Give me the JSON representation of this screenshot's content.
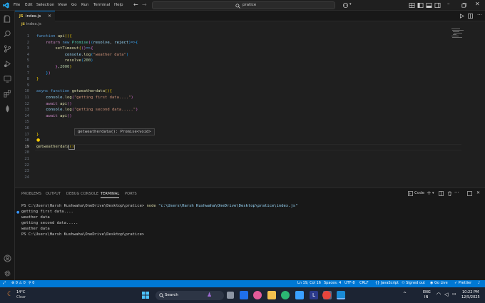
{
  "menu": [
    "File",
    "Edit",
    "Selection",
    "View",
    "Go",
    "Run",
    "Terminal",
    "Help"
  ],
  "command_center": "pratice",
  "tab": {
    "icon": "JS",
    "name": "index.js",
    "close": "×"
  },
  "breadcrumb": "index.js",
  "hover_text": "getweatherdata(): Promise<void>",
  "panel_tabs": [
    "PROBLEMS",
    "OUTPUT",
    "DEBUG CONSOLE",
    "TERMINAL",
    "PORTS"
  ],
  "terminal_type": "Code",
  "terminal": {
    "prompt1": "PS C:\\Users\\Harsh Kushwaha\\OneDrive\\Desktop\\pratice> ",
    "cmd": "node",
    "arg": " \"c:\\Users\\Harsh Kushwaha\\OneDrive\\Desktop\\pratice\\index.js\"",
    "out": [
      "getting first data....",
      "weather data",
      "getting second data.....",
      "weather data"
    ],
    "prompt2": "PS C:\\Users\\Harsh Kushwaha\\OneDrive\\Desktop\\pratice>"
  },
  "status": {
    "errors": "⊗ 0 ⚠ 0",
    "warnings": "0",
    "position": "Ln 19, Col 16",
    "spaces": "Spaces: 4",
    "encoding": "UTF-8",
    "eol": "CRLF",
    "language": "JavaScript",
    "account": "Signed out",
    "golive": "Go Live",
    "prettier": "Prettier"
  },
  "taskbar": {
    "weather_temp": "14°C",
    "weather_desc": "Clear",
    "search": "Search",
    "lang1": "ENG",
    "lang2": "IN",
    "time": "10:22 PM",
    "date": "12/5/2025"
  },
  "line_numbers": [
    "1",
    "2",
    "3",
    "4",
    "5",
    "6",
    "7",
    "8",
    "9",
    "10",
    "11",
    "12",
    "13",
    "14",
    "15",
    "16",
    "17",
    "18",
    "19",
    "20",
    "21",
    "22",
    "23",
    "24"
  ]
}
